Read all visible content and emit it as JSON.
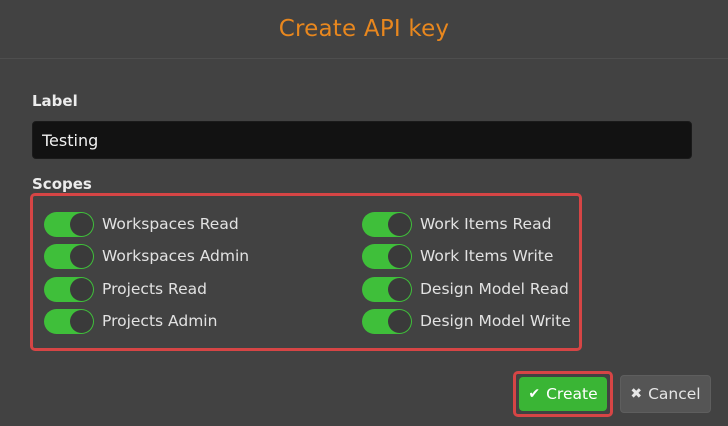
{
  "dialog": {
    "title": "Create API key",
    "label_field": {
      "label": "Label",
      "value": "Testing"
    },
    "scopes": {
      "label": "Scopes",
      "items": [
        {
          "label": "Workspaces Read",
          "enabled": true
        },
        {
          "label": "Workspaces Admin",
          "enabled": true
        },
        {
          "label": "Projects Read",
          "enabled": true
        },
        {
          "label": "Projects Admin",
          "enabled": true
        },
        {
          "label": "Work Items Read",
          "enabled": true
        },
        {
          "label": "Work Items Write",
          "enabled": true
        },
        {
          "label": "Design Model Read",
          "enabled": true
        },
        {
          "label": "Design Model Write",
          "enabled": true
        }
      ]
    },
    "buttons": {
      "create": {
        "label": "Create",
        "icon": "check-icon"
      },
      "cancel": {
        "label": "Cancel",
        "icon": "close-icon"
      }
    },
    "colors": {
      "title": "#e8871e",
      "toggle_on": "#3fbf3a",
      "create_button": "#3ab535",
      "highlight_border": "#d64545"
    }
  }
}
